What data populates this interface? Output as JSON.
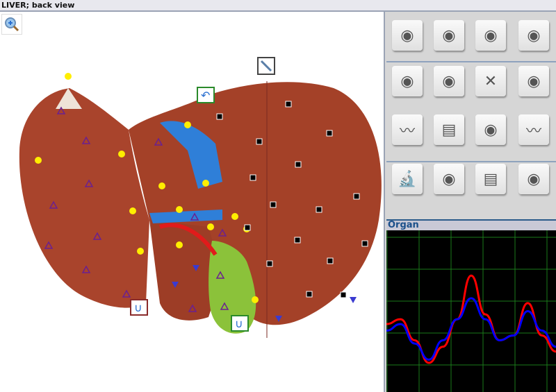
{
  "window": {
    "title": "LIVER; back view"
  },
  "toolbar": {
    "buttons": [
      "navigate-icon",
      "organ-cut-open-icon",
      "organ-cut-open-alt-icon",
      "organ-cells-icon",
      "measure-icon",
      "tissue-points-icon",
      "close-icon",
      "hexagon-cells-icon",
      "spectrum-search-icon",
      "compare-reports-icon",
      "organ-tree-icon",
      "spectrum-chart-icon",
      "microscope-icon",
      "magnet-search-icon",
      "notes-icon",
      "heart-atlas-icon"
    ]
  },
  "organ_panel": {
    "label": "Organ"
  },
  "chart_data": {
    "type": "line",
    "title": "Organ",
    "x": [
      0,
      1,
      2,
      3,
      4,
      5,
      6,
      7,
      8,
      9,
      10,
      11,
      12
    ],
    "series": [
      {
        "name": "red",
        "color": "#ff0000",
        "values": [
          0.42,
          0.45,
          0.32,
          0.18,
          0.28,
          0.45,
          0.72,
          0.48,
          0.32,
          0.35,
          0.55,
          0.35,
          0.25
        ]
      },
      {
        "name": "blue",
        "color": "#0000ff",
        "values": [
          0.38,
          0.42,
          0.3,
          0.2,
          0.32,
          0.45,
          0.58,
          0.45,
          0.32,
          0.35,
          0.5,
          0.38,
          0.28
        ]
      }
    ],
    "ylim": [
      0,
      1
    ],
    "grid": true
  },
  "colors": {
    "liver": "#a9442c",
    "gallbladder": "#8bc23a",
    "vein": "#2f7fd8",
    "artery": "#e01b1b"
  }
}
